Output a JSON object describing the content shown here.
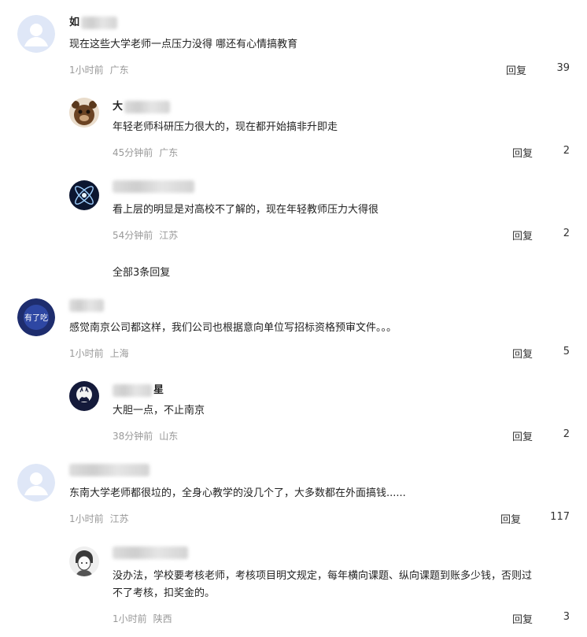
{
  "comments": [
    {
      "name_visible": "如",
      "text": "现在这些大学老师一点压力没得 哪还有心情搞教育",
      "time": "1小时前",
      "location": "广东",
      "reply_label": "回复",
      "likes": "39"
    },
    {
      "name_visible": "大",
      "text": "年轻老师科研压力很大的，现在都开始搞非升即走",
      "time": "45分钟前",
      "location": "广东",
      "reply_label": "回复",
      "likes": "2"
    },
    {
      "name_visible": "",
      "text": "看上层的明显是对高校不了解的，现在年轻教师压力大得很",
      "time": "54分钟前",
      "location": "江苏",
      "reply_label": "回复",
      "likes": "2"
    },
    {
      "name_visible": "",
      "text": "感觉南京公司都这样，我们公司也根据意向单位写招标资格预审文件。。。",
      "time": "1小时前",
      "location": "上海",
      "reply_label": "回复",
      "likes": "5"
    },
    {
      "name_visible": "星",
      "text": "大胆一点，不止南京",
      "time": "38分钟前",
      "location": "山东",
      "reply_label": "回复",
      "likes": "2"
    },
    {
      "name_visible": "",
      "text": "东南大学老师都很垃的，全身心教学的没几个了，大多数都在外面搞钱......",
      "time": "1小时前",
      "location": "江苏",
      "reply_label": "回复",
      "likes": "117"
    },
    {
      "name_visible": "",
      "text_line1": "没办法，学校要考核老师，考核项目明文规定，每年横向课题、纵向课题到账多少钱，否则过",
      "text_line2": "不了考核，扣奖金的。",
      "time": "1小时前",
      "location": "陕西",
      "reply_label": "回复",
      "likes": "3"
    }
  ],
  "all_replies_label": "全部3条回复",
  "avatar_badge_text": "有了吃"
}
